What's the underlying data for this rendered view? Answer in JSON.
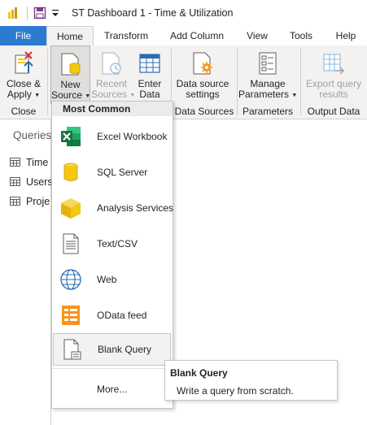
{
  "window": {
    "title": "ST Dashboard 1 - Time & Utilization"
  },
  "tabs": [
    "File",
    "Home",
    "Transform",
    "Add Column",
    "View",
    "Tools",
    "Help"
  ],
  "ribbon": {
    "close_apply": {
      "line1": "Close &",
      "line2": "Apply"
    },
    "new_source": {
      "line1": "New",
      "line2": "Source"
    },
    "recent_sources": {
      "line1": "Recent",
      "line2": "Sources"
    },
    "enter_data": {
      "line1": "Enter",
      "line2": "Data"
    },
    "data_source_settings": {
      "line1": "Data source",
      "line2": "settings"
    },
    "manage_parameters": {
      "line1": "Manage",
      "line2": "Parameters"
    },
    "export_query": {
      "line1": "Export query",
      "line2": "results"
    },
    "groups": {
      "close": "Close",
      "data_sources": "Data Sources",
      "parameters": "Parameters",
      "output_data": "Output Data"
    }
  },
  "left_pane": {
    "header": "Queries",
    "items": [
      "Time",
      "Users",
      "Proje"
    ]
  },
  "dropdown": {
    "header": "Most Common",
    "items": [
      "Excel Workbook",
      "SQL Server",
      "Analysis Services",
      "Text/CSV",
      "Web",
      "OData feed",
      "Blank Query"
    ],
    "more": "More..."
  },
  "tooltip": {
    "title": "Blank Query",
    "text": "Write a query from scratch."
  },
  "colors": {
    "accent": "#2b7bd1",
    "ribbon_bg": "#f3f2f1",
    "excel_green": "#1e7145",
    "sql_gold": "#f2c811",
    "odata_orange": "#f7941d",
    "web_blue": "#2b6cb0"
  }
}
